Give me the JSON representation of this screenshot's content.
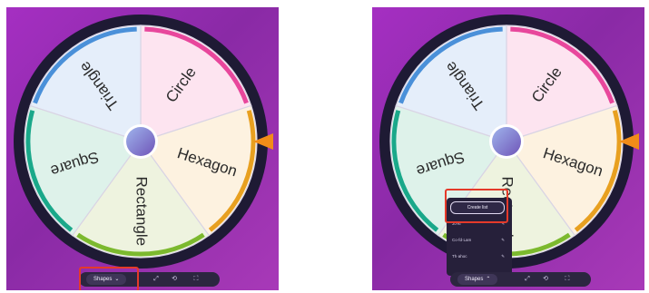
{
  "wheel": {
    "segments": [
      {
        "label": "Circle",
        "fill": "#fde4f0",
        "rim": "#e8479c"
      },
      {
        "label": "Hexagon",
        "fill": "#fdf2e0",
        "rim": "#e8a020"
      },
      {
        "label": "Rectangle",
        "fill": "#eef3df",
        "rim": "#7cb92e"
      },
      {
        "label": "Square",
        "fill": "#def2ea",
        "rim": "#1aa88a"
      },
      {
        "label": "Triangle",
        "fill": "#e5eefa",
        "rim": "#4a90d9"
      }
    ],
    "ring_color": "#1e1a34",
    "pointer_color": "#f28c18"
  },
  "left": {
    "toolbar": {
      "shapes_label": "Shapes",
      "chevron": "⌄",
      "icons": [
        "⤢",
        "⟲",
        "⛶"
      ]
    }
  },
  "right": {
    "toolbar": {
      "shapes_label": "Shapes",
      "chevron": "⌃",
      "icons": [
        "⤢",
        "⟲",
        "⛶"
      ]
    },
    "menu": {
      "first": "Create list",
      "items": [
        {
          "label": "Jo·ki",
          "icon": "✎"
        },
        {
          "label": "Co·fd·Lam",
          "icon": "✎"
        },
        {
          "label": "Th·ahoc",
          "icon": "✎"
        }
      ]
    }
  },
  "colors": {
    "highlight": "#e53a2a"
  }
}
